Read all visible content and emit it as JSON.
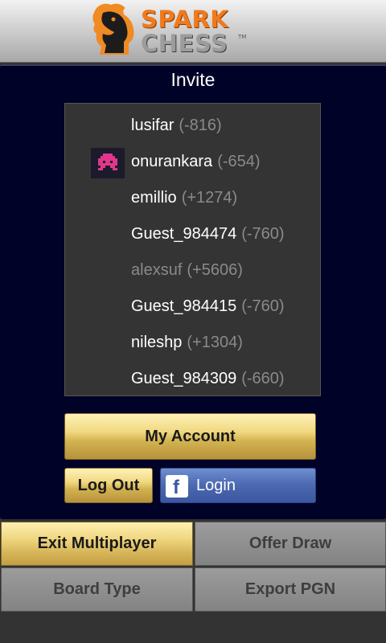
{
  "header": {
    "brand_top": "SPARK",
    "brand_bottom": "CHESS",
    "trademark": "TM"
  },
  "invite": {
    "title": "Invite",
    "players": [
      {
        "name": "lusifar",
        "rating": "(-816)",
        "online": true
      },
      {
        "name": "onurankara",
        "rating": "(-654)",
        "online": true
      },
      {
        "name": "emillio",
        "rating": "(+1274)",
        "online": true
      },
      {
        "name": "Guest_984474",
        "rating": "(-760)",
        "online": true
      },
      {
        "name": "alexsuf",
        "rating": "(+5606)",
        "online": false
      },
      {
        "name": "Guest_984415",
        "rating": "(-760)",
        "online": true
      },
      {
        "name": "nileshp",
        "rating": "(+1304)",
        "online": true
      },
      {
        "name": "Guest_984309",
        "rating": "(-660)",
        "online": true
      }
    ]
  },
  "account": {
    "my_account_label": "My Account",
    "logout_label": "Log Out",
    "facebook_login_label": "Login"
  },
  "bottom_menu": {
    "exit_multiplayer": "Exit Multiplayer",
    "offer_draw": "Offer Draw",
    "board_type": "Board Type",
    "export_pgn": "Export PGN"
  },
  "colors": {
    "panel_bg": "#000228",
    "gold_button": "#e6c56a",
    "facebook_blue": "#4b68b0",
    "disabled_gray": "#8e8e8e"
  }
}
